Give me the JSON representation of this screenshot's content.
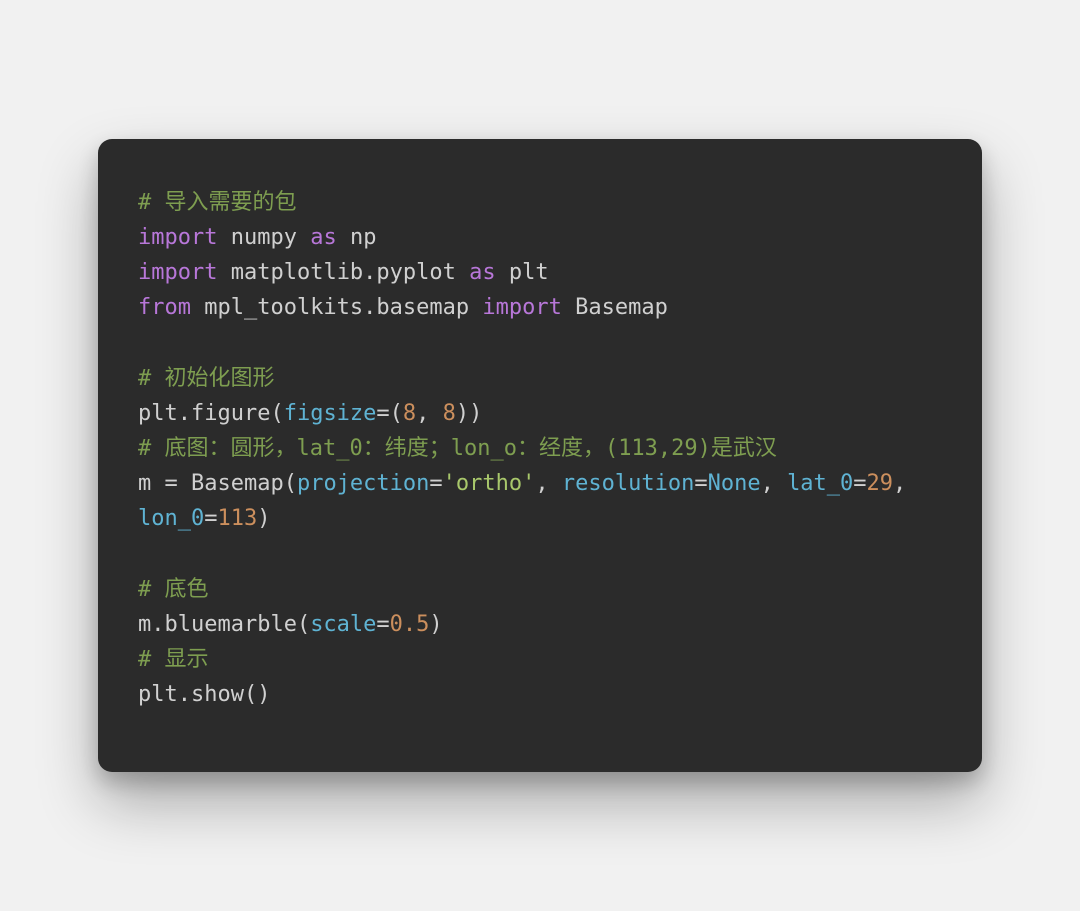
{
  "code": {
    "lines": [
      {
        "tokens": [
          {
            "cls": "comment",
            "text": "# 导入需要的包"
          }
        ]
      },
      {
        "tokens": [
          {
            "cls": "keyword",
            "text": "import"
          },
          {
            "cls": "plain",
            "text": " numpy "
          },
          {
            "cls": "keyword",
            "text": "as"
          },
          {
            "cls": "plain",
            "text": " np"
          }
        ]
      },
      {
        "tokens": [
          {
            "cls": "keyword",
            "text": "import"
          },
          {
            "cls": "plain",
            "text": " matplotlib.pyplot "
          },
          {
            "cls": "keyword",
            "text": "as"
          },
          {
            "cls": "plain",
            "text": " plt"
          }
        ]
      },
      {
        "tokens": [
          {
            "cls": "keyword",
            "text": "from"
          },
          {
            "cls": "plain",
            "text": " mpl_toolkits.basemap "
          },
          {
            "cls": "keyword",
            "text": "import"
          },
          {
            "cls": "plain",
            "text": " Basemap"
          }
        ]
      },
      {
        "tokens": [
          {
            "cls": "plain",
            "text": ""
          }
        ]
      },
      {
        "tokens": [
          {
            "cls": "comment",
            "text": "# 初始化图形"
          }
        ]
      },
      {
        "tokens": [
          {
            "cls": "plain",
            "text": "plt.figure("
          },
          {
            "cls": "kwarg",
            "text": "figsize"
          },
          {
            "cls": "plain",
            "text": "=("
          },
          {
            "cls": "number",
            "text": "8"
          },
          {
            "cls": "plain",
            "text": ", "
          },
          {
            "cls": "number",
            "text": "8"
          },
          {
            "cls": "plain",
            "text": "))"
          }
        ]
      },
      {
        "tokens": [
          {
            "cls": "comment",
            "text": "# 底图：圆形，lat_0：纬度；lon_o：经度，(113,29)是武汉"
          }
        ]
      },
      {
        "tokens": [
          {
            "cls": "plain",
            "text": "m = Basemap("
          },
          {
            "cls": "kwarg",
            "text": "projection"
          },
          {
            "cls": "plain",
            "text": "="
          },
          {
            "cls": "string",
            "text": "'ortho'"
          },
          {
            "cls": "plain",
            "text": ", "
          },
          {
            "cls": "kwarg",
            "text": "resolution"
          },
          {
            "cls": "plain",
            "text": "="
          },
          {
            "cls": "none",
            "text": "None"
          },
          {
            "cls": "plain",
            "text": ", "
          },
          {
            "cls": "kwarg",
            "text": "lat_0"
          },
          {
            "cls": "plain",
            "text": "="
          },
          {
            "cls": "number",
            "text": "29"
          },
          {
            "cls": "plain",
            "text": ", "
          },
          {
            "cls": "kwarg",
            "text": "lon_0"
          },
          {
            "cls": "plain",
            "text": "="
          },
          {
            "cls": "number",
            "text": "113"
          },
          {
            "cls": "plain",
            "text": ")"
          }
        ]
      },
      {
        "tokens": [
          {
            "cls": "plain",
            "text": ""
          }
        ]
      },
      {
        "tokens": [
          {
            "cls": "comment",
            "text": "# 底色"
          }
        ]
      },
      {
        "tokens": [
          {
            "cls": "plain",
            "text": "m.bluemarble("
          },
          {
            "cls": "kwarg",
            "text": "scale"
          },
          {
            "cls": "plain",
            "text": "="
          },
          {
            "cls": "number",
            "text": "0.5"
          },
          {
            "cls": "plain",
            "text": ")"
          }
        ]
      },
      {
        "tokens": [
          {
            "cls": "comment",
            "text": "# 显示"
          }
        ]
      },
      {
        "tokens": [
          {
            "cls": "plain",
            "text": "plt.show()"
          }
        ]
      }
    ]
  }
}
